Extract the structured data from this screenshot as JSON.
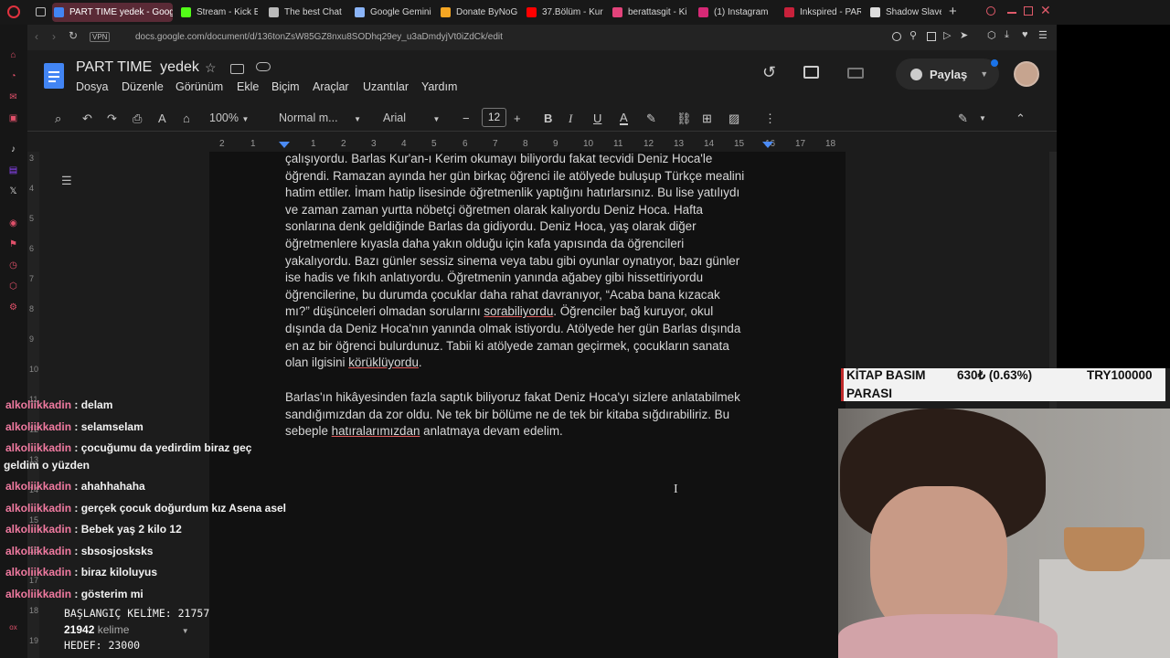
{
  "tabs": [
    {
      "label": "PART TIME yedek - Goog",
      "color": "#4285f4",
      "active": true
    },
    {
      "label": "Stream - Kick E",
      "color": "#53fc18"
    },
    {
      "label": "The best Chat",
      "color": "#bbbbbb"
    },
    {
      "label": "Google Gemini",
      "color": "#8ab4f8"
    },
    {
      "label": "Donate ByNoG",
      "color": "#f5a623"
    },
    {
      "label": "37.Bölüm - Kur",
      "color": "#ff0000"
    },
    {
      "label": "berattasgit - Ki",
      "color": "#e2437b"
    },
    {
      "label": "(1) Instagram",
      "color": "#d62976"
    },
    {
      "label": "Inkspired - PAR",
      "color": "#c8213b"
    },
    {
      "label": "Shadow Slave",
      "color": "#dddddd"
    }
  ],
  "address": {
    "vpn": "VPN",
    "url": "docs.google.com/document/d/136tonZsW85GZ8nxu8SODhq29ey_u3aDmdyjVt0iZdCk/edit"
  },
  "doc": {
    "title": "PART TIME  yedek",
    "share": "Paylaş"
  },
  "menu": [
    "Dosya",
    "Düzenle",
    "Görünüm",
    "Ekle",
    "Biçim",
    "Araçlar",
    "Uzantılar",
    "Yardım"
  ],
  "toolbar": {
    "zoom": "100%",
    "style": "Normal m...",
    "font": "Arial",
    "size": "12"
  },
  "ruler": [
    "2",
    "1",
    "1",
    "2",
    "3",
    "4",
    "5",
    "6",
    "7",
    "8",
    "9",
    "10",
    "11",
    "12",
    "13",
    "14",
    "15",
    "16",
    "17",
    "18"
  ],
  "vruler": [
    "3",
    "4",
    "5",
    "6",
    "7",
    "8",
    "9",
    "10",
    "11",
    "12",
    "13",
    "14",
    "15",
    "16",
    "17",
    "18",
    "19"
  ],
  "paragraph1": [
    "çalışıyordu. Barlas Kur'an-ı Kerim okumayı biliyordu fakat tecvidi Deniz Hoca'le",
    "öğrendi. Ramazan ayında her gün birkaç öğrenci ile atölyede buluşup Türkçe mealini",
    "hatim ettiler. İmam hatip lisesinde öğretmenlik yaptığını hatırlarsınız. Bu lise yatılıydı",
    "ve zaman zaman yurtta nöbetçi öğretmen olarak kalıyordu Deniz Hoca. Hafta",
    "sonlarına denk geldiğinde Barlas da gidiyordu. Deniz Hoca, yaş olarak diğer",
    "öğretmenlere kıyasla daha yakın olduğu için kafa yapısında da öğrencileri",
    "yakalıyordu. Bazı günler sessiz sinema veya tabu gibi oyunlar oynatıyor, bazı günler",
    "ise hadis ve fıkıh anlatıyordu. Öğretmenin yanında ağabey gibi hissettiriyordu",
    "öğrencilerine, bu durumda çocuklar daha rahat davranıyor, “Acaba bana kızacak",
    "mı?” düşünceleri olmadan sorularını sorabiliyordu. Öğrenciler bağ kuruyor, okul",
    "dışında da Deniz Hoca'nın yanında olmak istiyordu. Atölyede her gün Barlas dışında",
    "en az bir öğrenci bulurdunuz. Tabii ki atölyede zaman geçirmek, çocukların sanata",
    "olan ilgisini körüklüyordu."
  ],
  "paragraph2": [
    "Barlas'ın hikâyesinden fazla saptık biliyoruz fakat Deniz Hoca'yı sizlere anlatabilmek",
    "sandığımızdan da zor oldu. Ne tek bir bölüme ne de tek bir kitaba sığdırabiliriz. Bu",
    "sebeple hatıralarımızdan anlatmaya devam edelim."
  ],
  "chat": [
    {
      "user": "alkoliikkadin",
      "msg": "delam"
    },
    {
      "user": "alkoliikkadin",
      "msg": "selamselam"
    },
    {
      "user": "alkoliikkadin",
      "msg": "çocuğumu da yedirdim biraz geç",
      "cont": "geldim o yüzden"
    },
    {
      "user": "alkoliikkadin",
      "msg": "ahahhahaha"
    },
    {
      "user": "alkoliikkadin",
      "msg": "gerçek çocuk doğurdum kız Asena asel"
    },
    {
      "user": "alkoliikkadin",
      "msg": "Bebek yaş 2 kilo 12"
    },
    {
      "user": "alkoliikkadin",
      "msg": "sbsosjosksks"
    },
    {
      "user": "alkoliikkadin",
      "msg": "biraz kiloluyus"
    },
    {
      "user": "alkoliikkadin",
      "msg": "gösterim mi"
    }
  ],
  "counter": {
    "start": "BAŞLANGIÇ KELİME: 21757",
    "words": "21942",
    "words_label": "kelime",
    "target": "HEDEF: 23000"
  },
  "overlay": {
    "label1": "KİTAP BASIM",
    "label2": "PARASI",
    "value": "630₺ (0.63%)",
    "goal": "TRY100000"
  }
}
